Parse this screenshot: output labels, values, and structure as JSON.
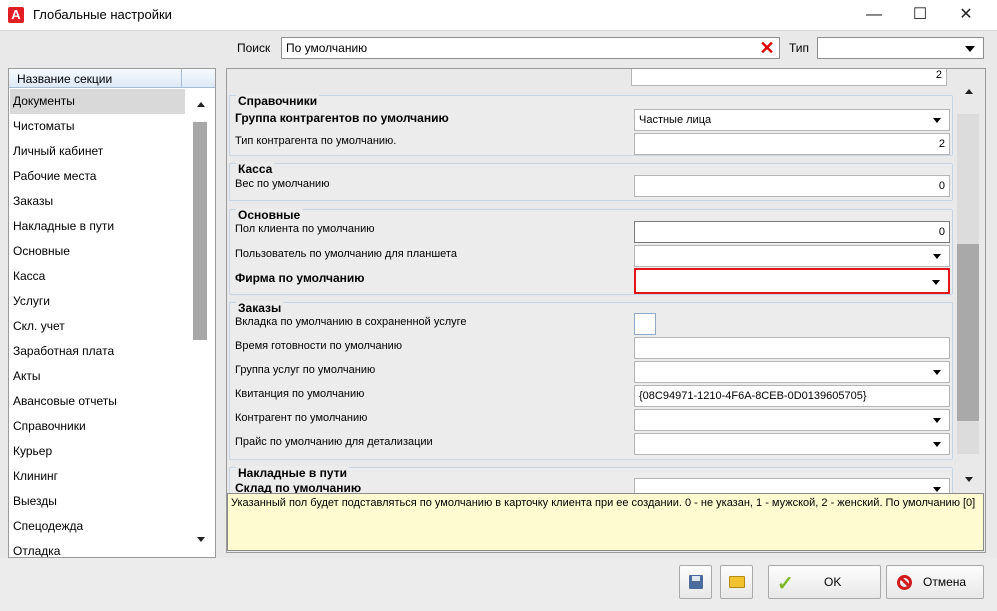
{
  "window": {
    "title": "Глобальные настройки",
    "app_logo": "A",
    "minimize_glyph": "—",
    "maximize_glyph": "☐",
    "close_glyph": "✕"
  },
  "search": {
    "label": "Поиск",
    "value": "По умолчанию",
    "clear_glyph": "✕",
    "type_label": "Тип",
    "type_value": ""
  },
  "sections": {
    "header": "Название секции",
    "items": [
      {
        "label": "Документы"
      },
      {
        "label": "Чистоматы"
      },
      {
        "label": "Личный кабинет"
      },
      {
        "label": "Рабочие места"
      },
      {
        "label": "Заказы"
      },
      {
        "label": "Накладные в пути"
      },
      {
        "label": "Основные"
      },
      {
        "label": "Касса"
      },
      {
        "label": "Услуги"
      },
      {
        "label": "Скл. учет"
      },
      {
        "label": "Заработная плата"
      },
      {
        "label": "Акты"
      },
      {
        "label": "Авансовые отчеты"
      },
      {
        "label": "Справочники"
      },
      {
        "label": "Курьер"
      },
      {
        "label": "Клининг"
      },
      {
        "label": "Выезды"
      },
      {
        "label": "Спецодежда"
      },
      {
        "label": "Отладка"
      }
    ],
    "selected": "Документы"
  },
  "settings": {
    "top_partial_value": "2",
    "spravochniki": {
      "title": "Справочники",
      "group_label": "Группа контрагентов по умолчанию",
      "group_value": "Частные лица",
      "type_label": "Тип контрагента по умолчанию.",
      "type_value": "2"
    },
    "kassa": {
      "title": "Касса",
      "weight_label": "Вес по умолчанию",
      "weight_value": "0"
    },
    "osnovnye": {
      "title": "Основные",
      "gender_label": "Пол клиента по умолчанию",
      "gender_value": "0",
      "tablet_user_label": "Пользователь по умолчанию для планшета",
      "tablet_user_value": "",
      "firm_label": "Фирма по умолчанию",
      "firm_value": ""
    },
    "zakazy": {
      "title": "Заказы",
      "tab_label": "Вкладка по умолчанию в сохраненной услуге",
      "ready_label": "Время готовности по умолчанию",
      "ready_value": "",
      "service_group_label": "Группа услуг по умолчанию",
      "service_group_value": "",
      "receipt_label": "Квитанция по умолчанию",
      "receipt_value": "{08C94971-1210-4F6A-8CEB-0D0139605705}",
      "contractor_label": "Контрагент по умолчанию",
      "contractor_value": "",
      "pricelist_label": "Прайс по умолчанию для детализации",
      "pricelist_value": ""
    },
    "nakladnye": {
      "title": "Накладные в пути",
      "warehouse_label": "Склад по умолчанию",
      "warehouse_value": ""
    }
  },
  "description": "Указанный пол будет подставляться по умолчанию в карточку клиента при ее создании. 0 - не указан, 1 - мужской, 2 - женский. По умолчанию [0]",
  "buttons": {
    "save_icon": "save-icon",
    "folder_icon": "folder-icon",
    "ok_label": "OK",
    "cancel_label": "Отмена"
  },
  "colors": {
    "highlight_border": "#e2171c",
    "description_bg": "#fffbd0",
    "logo_red": "#e31e24"
  }
}
